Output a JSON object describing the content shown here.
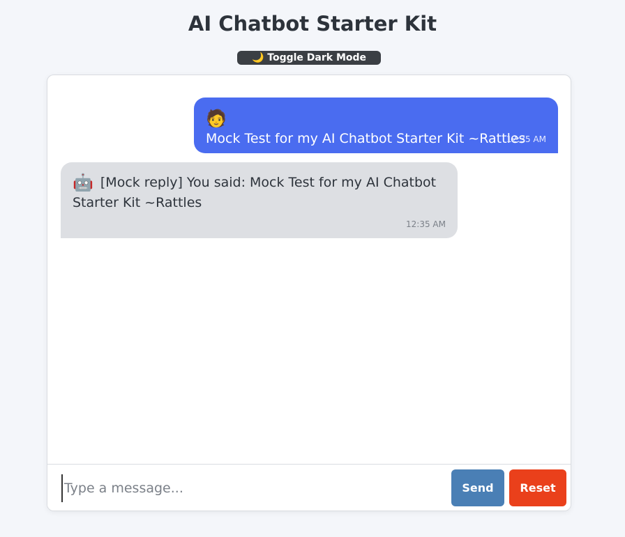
{
  "header": {
    "title": "AI Chatbot Starter Kit",
    "toggle_label": "🌙 Toggle Dark Mode"
  },
  "messages": [
    {
      "role": "user",
      "avatar": "🧑",
      "text": "Mock Test for my AI Chatbot Starter Kit ~Rattles",
      "time": "12:35 AM"
    },
    {
      "role": "bot",
      "avatar": "🤖",
      "text": "[Mock reply] You said: Mock Test for my AI Chatbot Starter Kit ~Rattles",
      "time": "12:35 AM"
    }
  ],
  "composer": {
    "value": "",
    "placeholder": "Type a message...",
    "send_label": "Send",
    "reset_label": "Reset"
  },
  "colors": {
    "user_bubble": "#4a6cf0",
    "bot_bubble": "#dddfe3",
    "send_button": "#4a7fb5",
    "reset_button": "#ea401b",
    "toggle_button": "#3b3f44"
  }
}
